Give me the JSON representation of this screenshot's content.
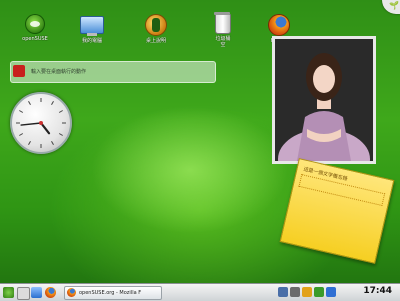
{
  "desktop": {
    "icons": [
      {
        "label": "openSUSE",
        "icon": "opensuse-icon"
      },
      {
        "label": "我的電腦",
        "icon": "computer-icon"
      },
      {
        "label": "桌上說明",
        "icon": "help-icon"
      },
      {
        "label": "垃圾桶\n空",
        "icon": "trash-icon"
      },
      {
        "label": "Firefox",
        "icon": "firefox-icon"
      }
    ],
    "search_widget": {
      "placeholder": "輸入要在桌面執行的動作"
    },
    "clock_widget": {
      "hour": 4,
      "minute": 44
    },
    "note_widget": {
      "text": "這是一個文字備忘錄"
    }
  },
  "taskbar": {
    "active_task": "openSUSE.org - Mozilla F",
    "clock": "17:44"
  },
  "colors": {
    "desktop_green": "#3fa81b",
    "note_yellow": "#f6cf22",
    "taskbar": "#e6e8ea"
  }
}
